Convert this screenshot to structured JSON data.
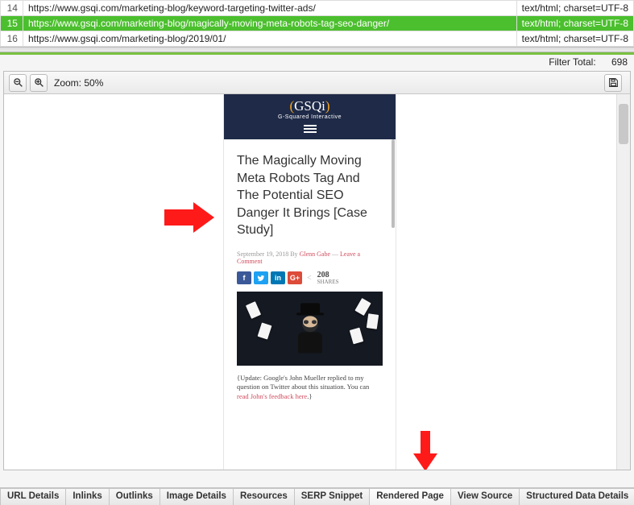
{
  "url_rows": [
    {
      "num": "14",
      "url": "https://www.gsqi.com/marketing-blog/keyword-targeting-twitter-ads/",
      "content_type": "text/html; charset=UTF-8",
      "selected": false
    },
    {
      "num": "15",
      "url": "https://www.gsqi.com/marketing-blog/magically-moving-meta-robots-tag-seo-danger/",
      "content_type": "text/html; charset=UTF-8",
      "selected": true
    },
    {
      "num": "16",
      "url": "https://www.gsqi.com/marketing-blog/2019/01/",
      "content_type": "text/html; charset=UTF-8",
      "selected": false
    }
  ],
  "filter": {
    "label": "Filter Total:",
    "count": "698"
  },
  "toolbar": {
    "zoom_label": "Zoom: 50%"
  },
  "rendered": {
    "brand": "GSQi",
    "brand_sub": "G-Squared Interactive",
    "title": "The Magically Moving Meta Robots Tag And The Potential SEO Danger It Brings [Case Study]",
    "date": "September 19, 2018",
    "byline_prefix": "By",
    "author": "Glenn Gabe",
    "dash": "—",
    "comment_link": "Leave a Comment",
    "shares_count": "208",
    "shares_label": "SHARES",
    "update_pre": "{Update: Google's John Mueller replied to my question on Twitter about this situation. You can ",
    "update_link": "read John's feedback here",
    "update_post": ".}"
  },
  "tabs": {
    "t0": "URL Details",
    "t1": "Inlinks",
    "t2": "Outlinks",
    "t3": "Image Details",
    "t4": "Resources",
    "t5": "SERP Snippet",
    "t6": "Rendered Page",
    "t7": "View Source",
    "t8": "Structured Data Details"
  }
}
